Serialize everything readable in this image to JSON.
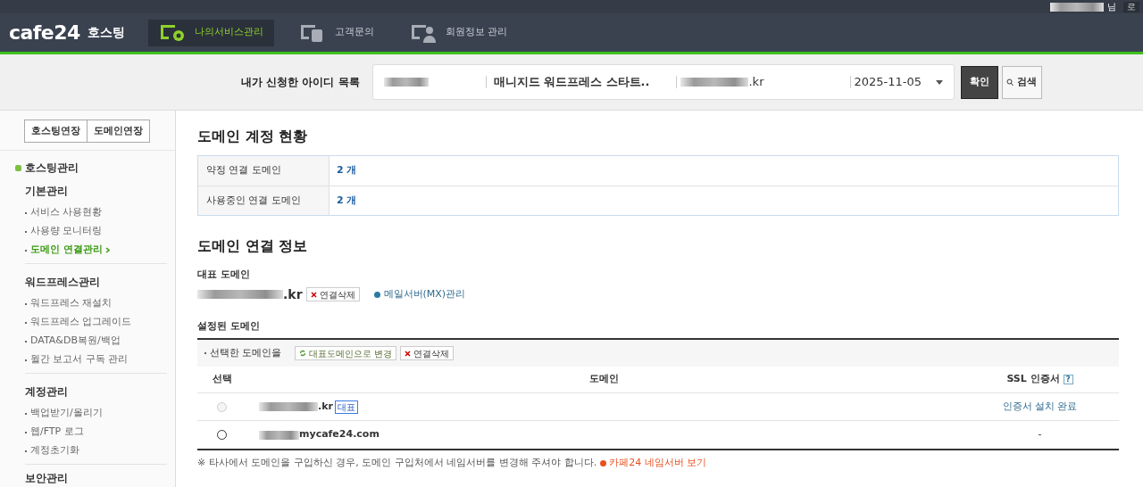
{
  "top_bar": {
    "user_suffix": "님",
    "logout": "로"
  },
  "header": {
    "logo": "cafe24",
    "logo_sub": "호스팅",
    "nav": [
      {
        "label": "나의서비스관리",
        "selected": true
      },
      {
        "label": "고객문의",
        "selected": false
      },
      {
        "label": "회원정보 관리",
        "selected": false
      }
    ]
  },
  "id_selector": {
    "label": "내가 신청한 아이디 목록",
    "product": "매니지드 워드프레스 스타트..",
    "domain_suffix": ".kr",
    "date": "2025-11-05",
    "confirm": "확인",
    "search": "검색"
  },
  "sidebar": {
    "buttons": [
      "호스팅연장",
      "도메인연장"
    ],
    "title": "호스팅관리",
    "groups": [
      {
        "title": "기본관리",
        "items": [
          {
            "label": "서비스 사용현황",
            "selected": false
          },
          {
            "label": "사용량 모니터링",
            "selected": false
          },
          {
            "label": "도메인 연결관리",
            "selected": true
          }
        ]
      },
      {
        "title": "워드프레스관리",
        "items": [
          {
            "label": "워드프레스 재설치",
            "selected": false
          },
          {
            "label": "워드프레스 업그레이드",
            "selected": false
          },
          {
            "label": "DATA&DB복원/백업",
            "selected": false
          },
          {
            "label": "월간 보고서 구독 관리",
            "selected": false
          }
        ]
      },
      {
        "title": "계정관리",
        "items": [
          {
            "label": "백업받기/올리기",
            "selected": false
          },
          {
            "label": "웹/FTP 로그",
            "selected": false
          },
          {
            "label": "계정초기화",
            "selected": false
          }
        ]
      },
      {
        "title": "보안관리"
      }
    ]
  },
  "status": {
    "title": "도메인 계정 현황",
    "rows": [
      {
        "label": "약정 연결 도메인",
        "value": "2 개"
      },
      {
        "label": "사용중인 연결 도메인",
        "value": "2 개"
      }
    ]
  },
  "info": {
    "title": "도메인 연결 정보",
    "primary_label": "대표 도메인",
    "primary_suffix": ".kr",
    "delete": "연결삭제",
    "mx": "메일서버(MX)관리",
    "configured_label": "설정된 도메인",
    "action_label": "선택한 도메인을",
    "set_primary": "대표도메인으로 변경",
    "delete2": "연결삭제",
    "columns": [
      "선택",
      "도메인",
      "SSL 인증서"
    ],
    "help": "?",
    "rows": [
      {
        "suffix": ".kr",
        "badge": "대표",
        "ssl": "인증서 설치 완료",
        "disabled": true
      },
      {
        "suffix": "mycafe24.com",
        "ssl": "-",
        "disabled": false
      }
    ],
    "note": "※ 타사에서 도메인을 구입하신 경우, 도메인 구입처에서 네임서버를 변경해 주셔야 합니다.",
    "note_link": "카페24 네임서버 보기"
  }
}
